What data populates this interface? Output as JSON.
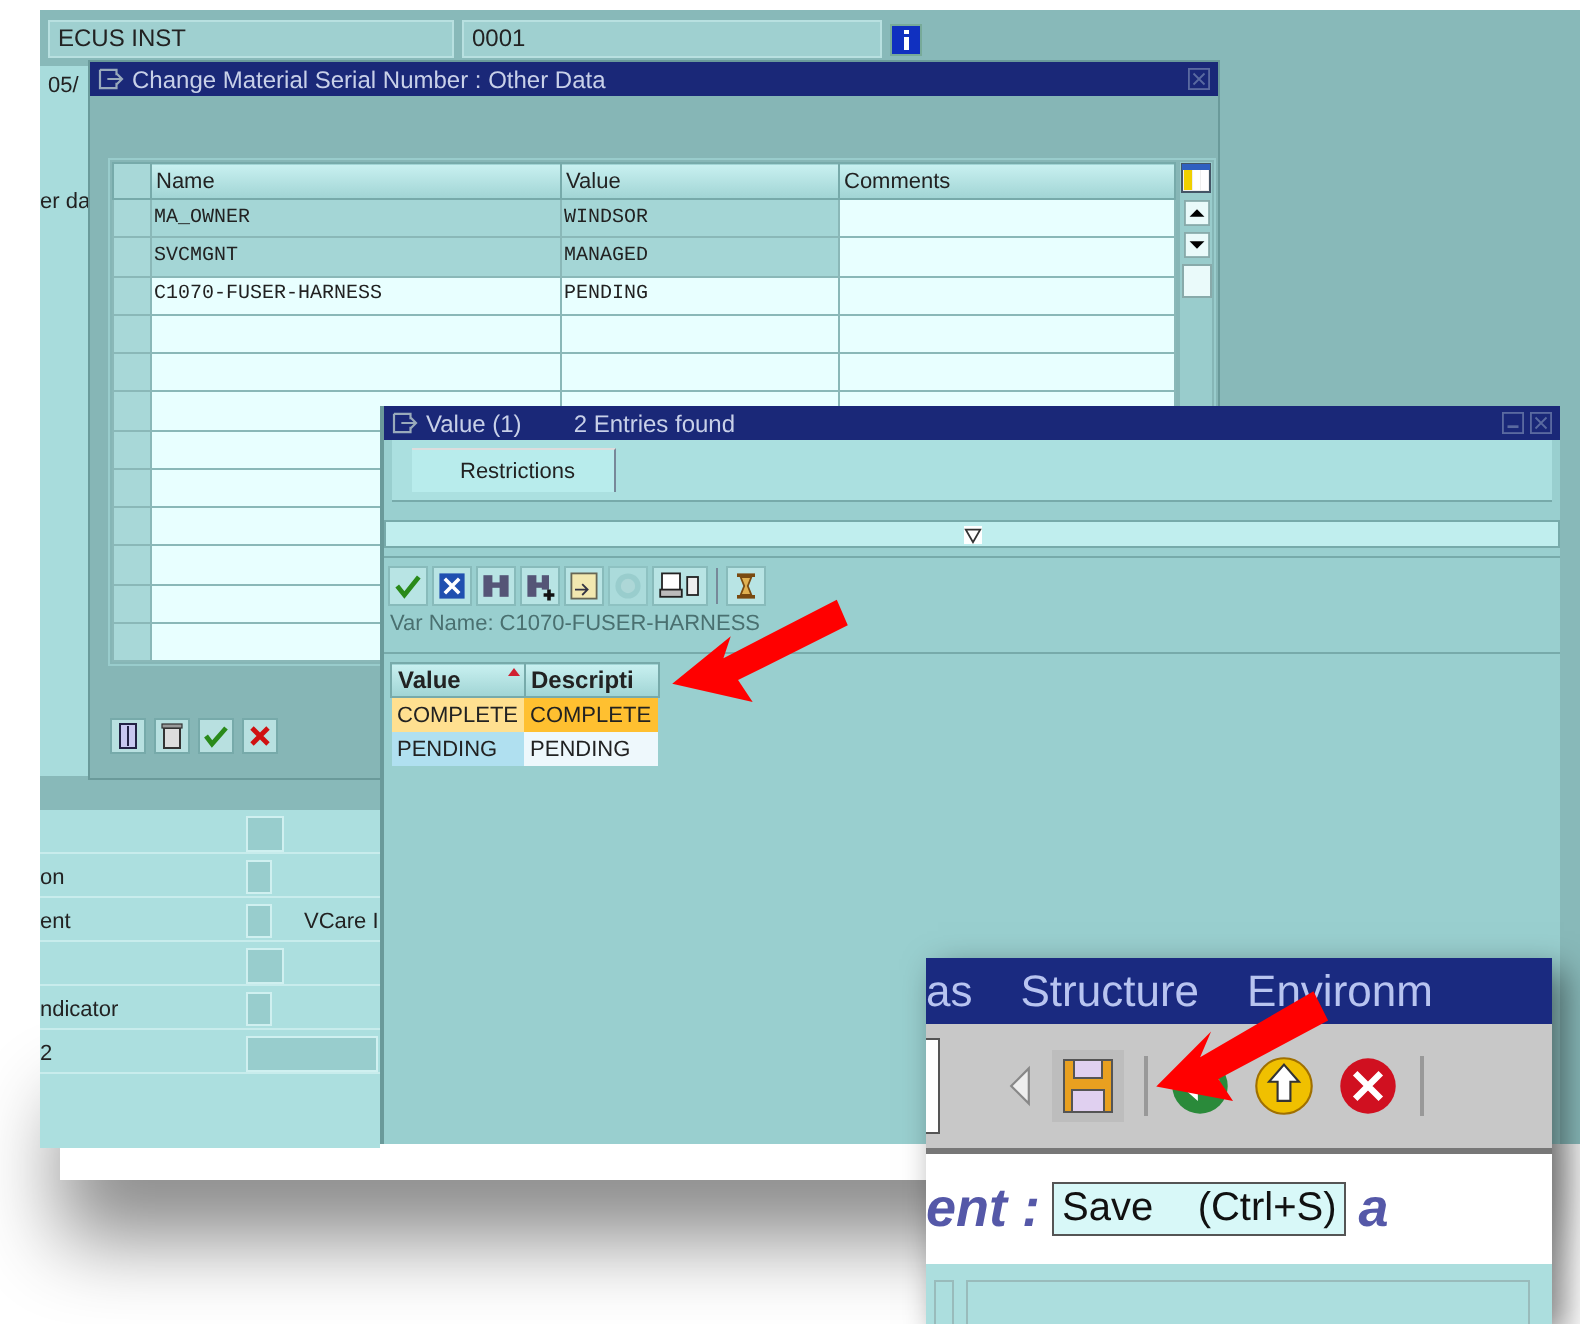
{
  "top_fields": [
    "ECUS INST",
    "0001"
  ],
  "left_labels": [
    "05/",
    "er da"
  ],
  "lower_fields": [
    {
      "kind": "field"
    },
    {
      "kind": "checkbox",
      "label": "on",
      "checked": false
    },
    {
      "kind": "checkbox",
      "label": "ent",
      "checked": false,
      "side_label": "VCare I"
    },
    {
      "kind": "field"
    },
    {
      "kind": "checkbox",
      "label": "ndicator",
      "checked": false
    },
    {
      "kind": "longfield",
      "label": "2"
    }
  ],
  "other_data_dialog": {
    "title": "Change Material Serial Number : Other Data",
    "columns": [
      "Name",
      "Value",
      "Comments"
    ],
    "rows": [
      {
        "name": "MA_OWNER",
        "value": "WINDSOR"
      },
      {
        "name": "SVCMGNT",
        "value": "MANAGED"
      },
      {
        "name": "C1070-FUSER-HARNESS",
        "value": "PENDING"
      }
    ]
  },
  "value_dialog": {
    "title": "Value (1)",
    "subtitle": "2 Entries found",
    "tabs": [
      {
        "label": "Restrictions",
        "selected": true
      }
    ],
    "var_name": "Var Name: C1070-FUSER-HARNESS",
    "columns": [
      {
        "label": "Value",
        "sorted": true
      },
      {
        "label": "Descripti",
        "sorted": false
      }
    ],
    "rows": [
      {
        "value": "COMPLETE",
        "description": "COMPLETE",
        "selected": true
      },
      {
        "value": "PENDING",
        "description": "PENDING",
        "selected": false
      }
    ]
  },
  "inset": {
    "menu": [
      "as",
      "Structure",
      "Environm"
    ],
    "heading": "ent :",
    "heading_tail": "a",
    "tooltip": "Save    (Ctrl+S)"
  }
}
